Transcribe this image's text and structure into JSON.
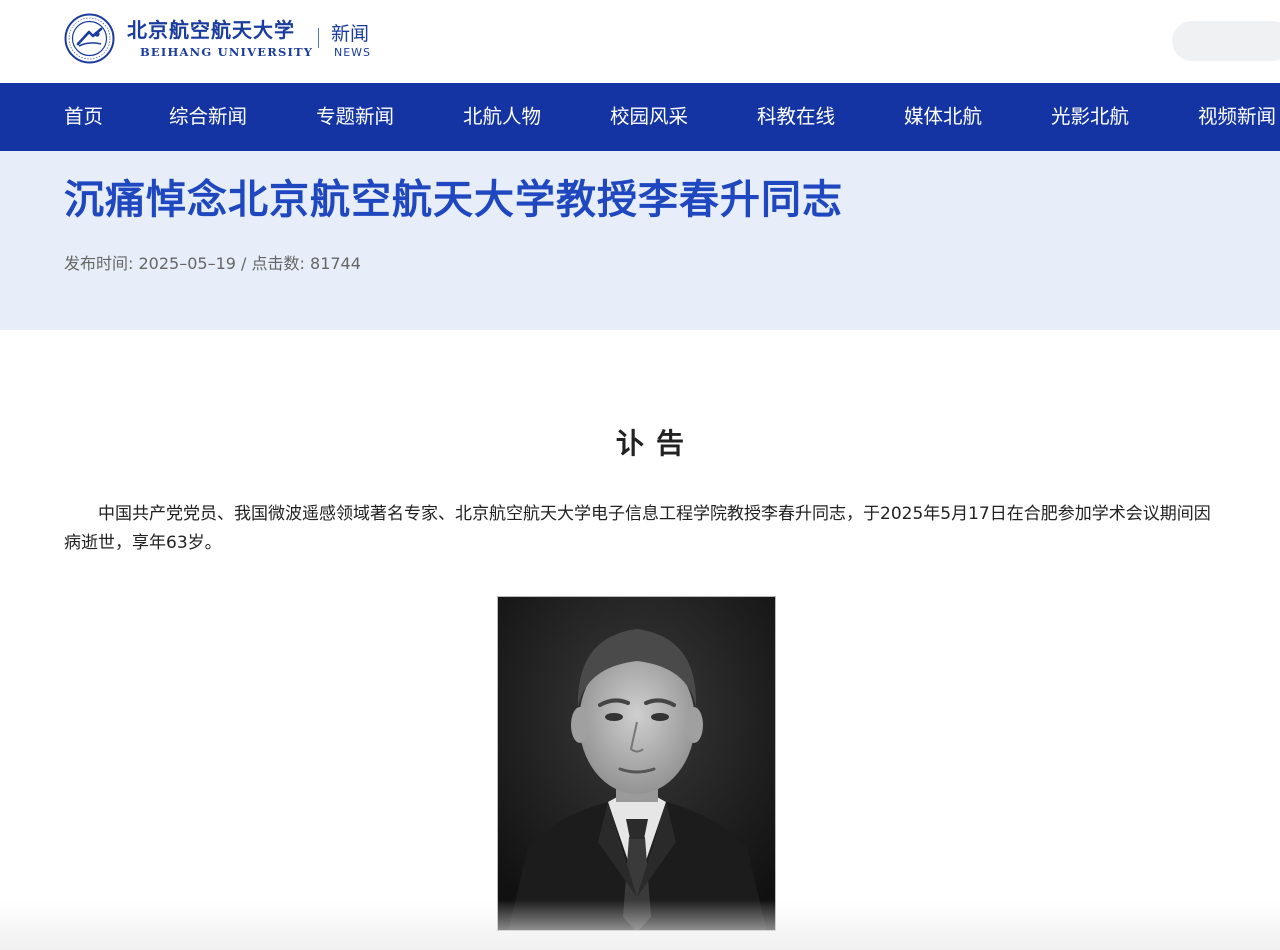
{
  "header": {
    "logo_cn": "北京航空航天大学",
    "logo_en": "BEIHANG UNIVERSITY",
    "section_cn": "新闻",
    "section_en": "NEWS"
  },
  "nav": {
    "items": [
      {
        "label": "首页"
      },
      {
        "label": "综合新闻"
      },
      {
        "label": "专题新闻"
      },
      {
        "label": "北航人物"
      },
      {
        "label": "校园风采"
      },
      {
        "label": "科教在线"
      },
      {
        "label": "媒体北航"
      },
      {
        "label": "光影北航"
      },
      {
        "label": "视频新闻"
      }
    ]
  },
  "article": {
    "title": "沉痛悼念北京航空航天大学教授李春升同志",
    "publish_label": "发布时间:",
    "publish_date": "2025–05–19",
    "separator": "/",
    "views_label": "点击数:",
    "views": "81744",
    "heading": "讣告",
    "paragraph": "中国共产党党员、我国微波遥感领域著名专家、北京航空航天大学电子信息工程学院教授李春升同志，于2025年5月17日在合肥参加学术会议期间因病逝世，享年63岁。"
  },
  "colors": {
    "nav_bg": "#1534a4",
    "title_band_bg": "#e7eef9",
    "title_text": "#1f48c0"
  }
}
